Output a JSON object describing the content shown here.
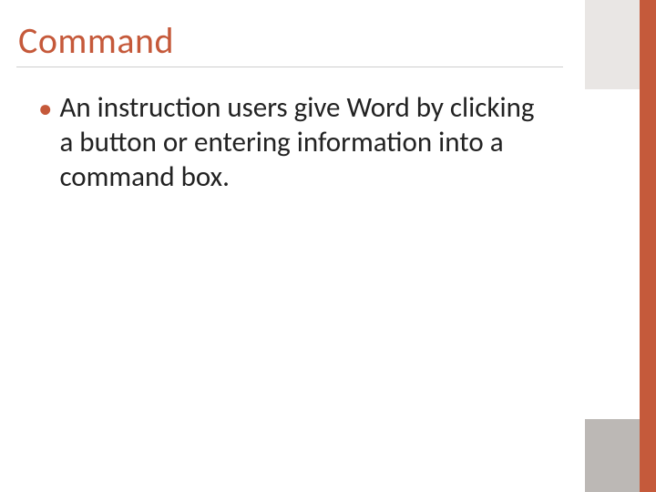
{
  "title": "Command",
  "bullets": [
    "An instruction users give Word by clicking a button or entering information into a command box."
  ]
}
